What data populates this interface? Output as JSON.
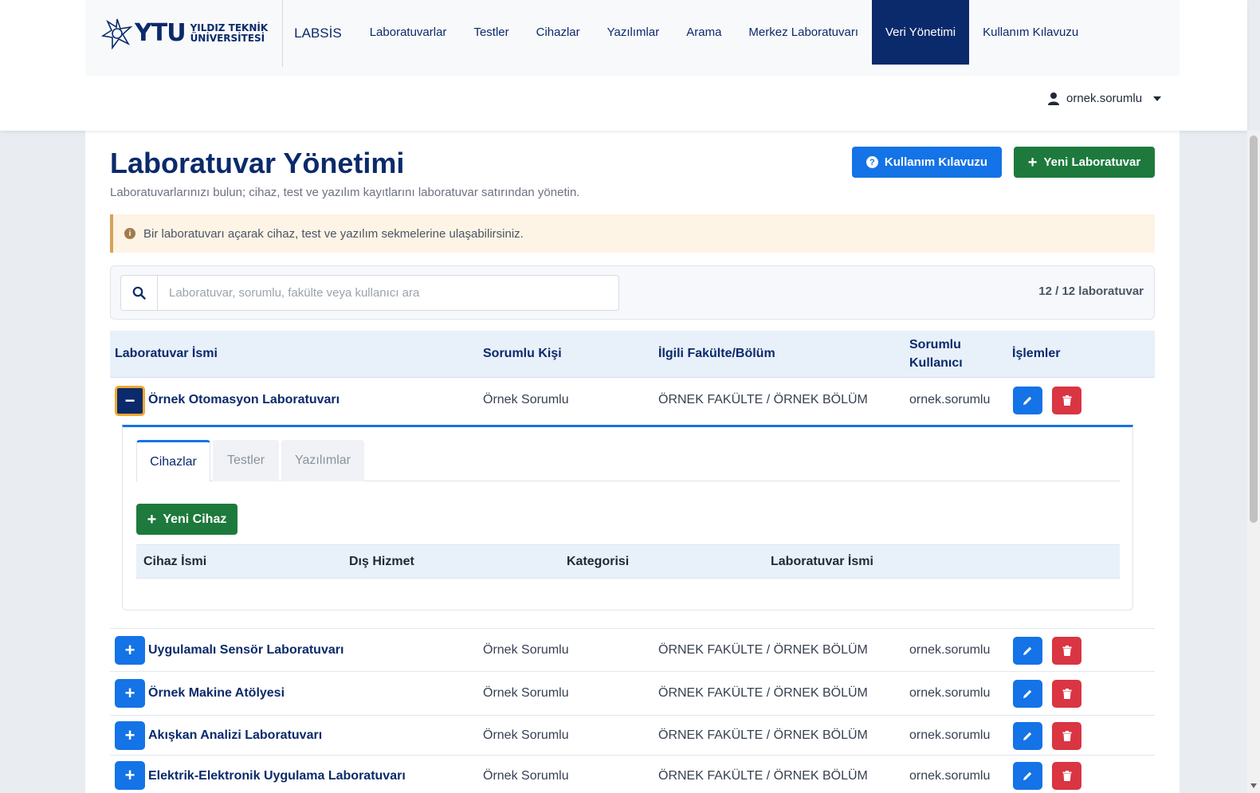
{
  "header": {
    "logo_ytu": "YTU",
    "logo_line1": "YILDIZ TEKNİK",
    "logo_line2": "ÜNİVERSİTESİ",
    "brand": "LABSİS",
    "nav": [
      {
        "label": "Laboratuvarlar"
      },
      {
        "label": "Testler"
      },
      {
        "label": "Cihazlar"
      },
      {
        "label": "Yazılımlar"
      },
      {
        "label": "Arama"
      },
      {
        "label": "Merkez Laboratuvarı"
      },
      {
        "label": "Veri Yönetimi",
        "active": true
      },
      {
        "label": "Kullanım Kılavuzu"
      }
    ],
    "user": "ornek.sorumlu"
  },
  "page": {
    "title": "Laboratuvar Yönetimi",
    "subtitle": "Laboratuvarlarınızı bulun; cihaz, test ve yazılım kayıtlarını laboratuvar satırından yönetin.",
    "guide_button": "Kullanım Kılavuzu",
    "new_lab_button": "Yeni Laboratuvar",
    "alert": "Bir laboratuvarı açarak cihaz, test ve yazılım sekmelerine ulaşabilirsiniz."
  },
  "search": {
    "placeholder": "Laboratuvar, sorumlu, fakülte veya kullanıcı ara",
    "value": "",
    "count": "12 / 12 laboratuvar"
  },
  "table": {
    "headers": {
      "name": "Laboratuvar İsmi",
      "person": "Sorumlu Kişi",
      "faculty": "İlgili Fakülte/Bölüm",
      "user_line1": "Sorumlu",
      "user_line2": "Kullanıcı",
      "actions": "İşlemler"
    },
    "rows": [
      {
        "name": "Örnek Otomasyon Laboratuvarı",
        "person": "Örnek Sorumlu",
        "faculty": "ÖRNEK FAKÜLTE / ÖRNEK BÖLÜM",
        "user": "ornek.sorumlu",
        "expanded": true
      },
      {
        "name": "Uygulamalı Sensör Laboratuvarı",
        "person": "Örnek Sorumlu",
        "faculty": "ÖRNEK FAKÜLTE / ÖRNEK BÖLÜM",
        "user": "ornek.sorumlu"
      },
      {
        "name": "Örnek Makine Atölyesi",
        "person": "Örnek Sorumlu",
        "faculty": "ÖRNEK FAKÜLTE / ÖRNEK BÖLÜM",
        "user": "ornek.sorumlu"
      },
      {
        "name": "Akışkan Analizi Laboratuvarı",
        "person": "Örnek Sorumlu",
        "faculty": "ÖRNEK FAKÜLTE / ÖRNEK BÖLÜM",
        "user": "ornek.sorumlu"
      },
      {
        "name": "Elektrik-Elektronik Uygulama Laboratuvarı",
        "person": "Örnek Sorumlu",
        "faculty": "ÖRNEK FAKÜLTE / ÖRNEK BÖLÜM",
        "user": "ornek.sorumlu"
      }
    ]
  },
  "detail": {
    "tabs": [
      {
        "label": "Cihazlar",
        "active": true
      },
      {
        "label": "Testler"
      },
      {
        "label": "Yazılımlar"
      }
    ],
    "new_device_button": "Yeni Cihaz",
    "columns": [
      "Cihaz İsmi",
      "Dış Hizmet",
      "Kategorisi",
      "Laboratuvar İsmi"
    ]
  },
  "colors": {
    "navy": "#0b2a6b",
    "primary": "#1473e6",
    "success": "#1d7a3c",
    "danger": "#d93543",
    "alert_bg": "#fdf4e6",
    "focus_ring": "#f0a830"
  },
  "icons": {
    "logo": "ytu-star-logo-icon",
    "user": "user-icon",
    "help": "question-circle-icon",
    "plus": "plus-icon",
    "minus": "minus-icon",
    "info": "info-circle-icon",
    "search": "search-icon",
    "edit": "pencil-icon",
    "delete": "trash-icon"
  }
}
